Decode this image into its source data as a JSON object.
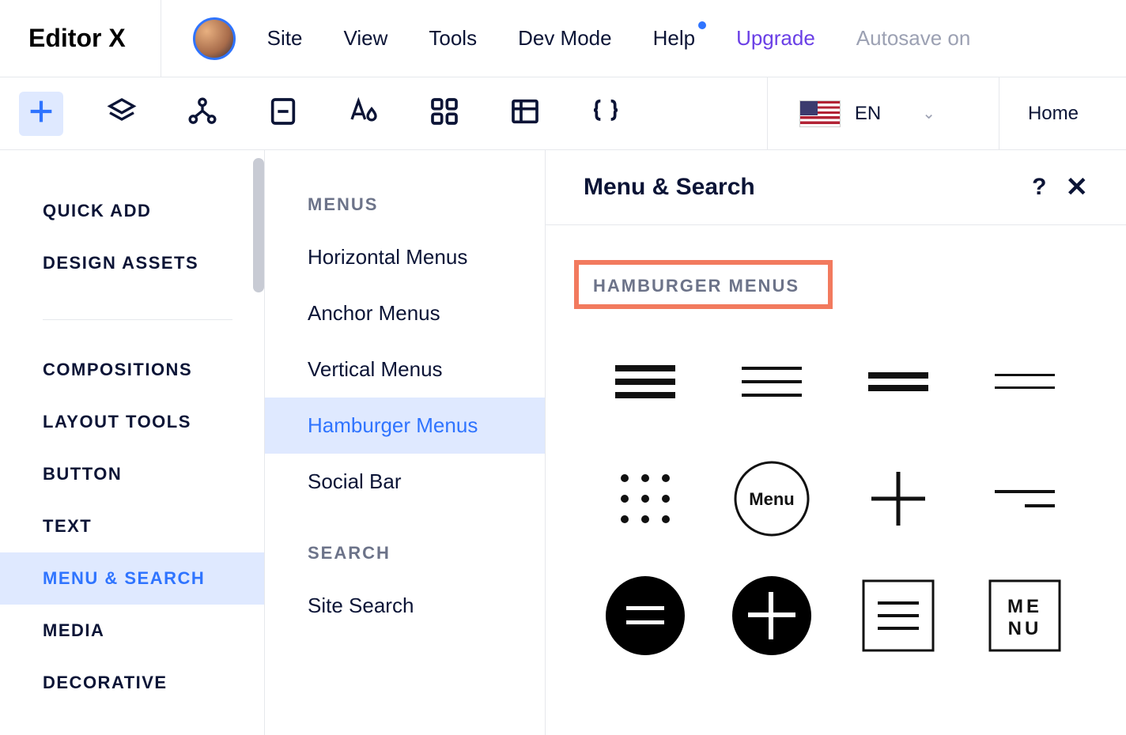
{
  "topbar": {
    "logo": "Editor X",
    "menu": [
      "Site",
      "View",
      "Tools",
      "Dev Mode",
      "Help"
    ],
    "upgrade": "Upgrade",
    "autosave": "Autosave on"
  },
  "toolbar": {
    "lang_code": "EN",
    "page": "Home"
  },
  "sidebar": {
    "top": [
      "QUICK ADD",
      "DESIGN ASSETS"
    ],
    "main": [
      "COMPOSITIONS",
      "LAYOUT TOOLS",
      "BUTTON",
      "TEXT",
      "MENU & SEARCH",
      "MEDIA",
      "DECORATIVE"
    ],
    "selected": "MENU & SEARCH"
  },
  "subpanel": {
    "groups": [
      {
        "heading": "MENUS",
        "items": [
          "Horizontal Menus",
          "Anchor Menus",
          "Vertical Menus",
          "Hamburger Menus",
          "Social Bar"
        ]
      },
      {
        "heading": "SEARCH",
        "items": [
          "Site Search"
        ]
      }
    ],
    "selected": "Hamburger Menus"
  },
  "content": {
    "title": "Menu & Search",
    "section": "HAMBURGER MENUS",
    "menu_text": "Menu",
    "menu_box": "ME\nNU"
  }
}
